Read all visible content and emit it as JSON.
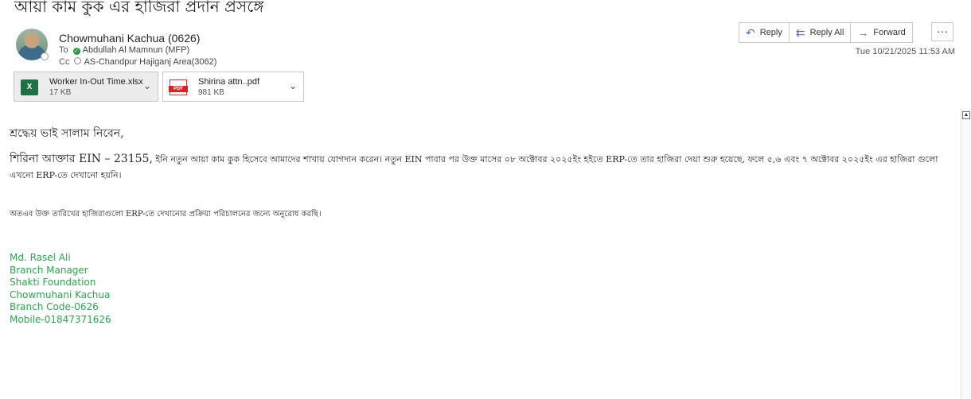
{
  "email": {
    "subject": "আয়া কাম কুক এর হাজিরা প্রদান প্রসঙ্গে",
    "sender": "Chowmuhani Kachua (0626)",
    "to_label": "To",
    "to": "Abdullah Al Mamnun (MFP)",
    "cc_label": "Cc",
    "cc": "AS-Chandpur Hajiganj Area(3062)",
    "date": "Tue 10/21/2025 11:53 AM"
  },
  "attachments": [
    {
      "name": "Worker In-Out Time.xlsx",
      "size": "17 KB",
      "icon": "excel-file-icon"
    },
    {
      "name": "Shirina attn..pdf",
      "size": "981 KB",
      "icon": "pdf-file-icon"
    }
  ],
  "actions": {
    "reply": "Reply",
    "reply_all": "Reply All",
    "forward": "Forward",
    "more": "···"
  },
  "body": {
    "greeting": "শ্রদ্ধেয় ভাই সালাম নিবেন,",
    "para1_lead": "শিরিনা আক্তার EIN – 23155,",
    "para1_rest": " ইনি নতুন আয়া কাম কুক হিসেবে আমাদের শাখায় যোগদান করেন। নতুন EIN পাবার পর উক্ত মাসের ০৮ অক্টোবর ২০২৫ইং হইতে ERP-তে তার হাজিরা দেয়া শুরু হয়েছে, ফলে ৫,৬ এবং ৭ অক্টোবর ২০২৫ইং এর হাজিরা গুলো এখনো ERP-তে দেখানো হয়নি।",
    "para2": "অতএব উক্ত তারিখের হাজিরাগুলো ERP-তে দেখানোর প্রক্রিয়া পরিচালনের জন্যে অনুরোধ করছি।"
  },
  "signature": {
    "name": "Md. Rasel Ali",
    "title": "Branch Manager",
    "org": "Shakti Foundation",
    "branch": "Chowmuhani Kachua",
    "code": "Branch Code-0626",
    "mobile": "Mobile-01847371626"
  },
  "colors": {
    "signature": "#2aa84a",
    "accent_icon": "#4a6fd0"
  }
}
